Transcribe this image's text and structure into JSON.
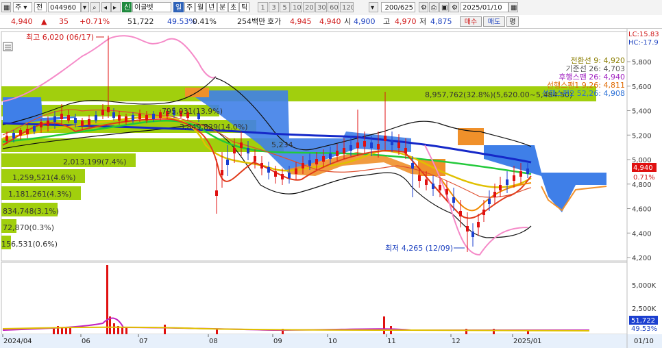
{
  "toolbar": {
    "period_mode": "주",
    "market_mode": "전",
    "code": "044960",
    "stock_tag": "신",
    "stock_name": "이글벳",
    "period_tabs": [
      "일",
      "주",
      "월",
      "년",
      "분",
      "초",
      "틱"
    ],
    "intervals": [
      "1",
      "3",
      "5",
      "10",
      "20",
      "30",
      "60",
      "120"
    ],
    "count": "200/625",
    "date": "2025/01/10"
  },
  "quote": {
    "price": "4,940",
    "change": "35",
    "change_rate": "+0.71%",
    "volume": "51,722",
    "volume_ratio": "49.53%",
    "turnover_rate": "0.41%",
    "amount": "254백만",
    "ask_label": "호가",
    "ask": "4,945",
    "bid": "4,940",
    "open_label": "시",
    "open": "4,900",
    "high_label": "고",
    "high": "4,970",
    "low_label": "저",
    "low": "4,875",
    "buy_label": "매수",
    "sell_label": "매도",
    "eval_label": "평"
  },
  "chart": {
    "corner_lc": "LC:15.83",
    "corner_hc": "HC:-17.9",
    "price_ticks": [
      "5,800",
      "5,600",
      "5,400",
      "5,200",
      "5,000",
      "4,800",
      "4,600",
      "4,400",
      "4,200"
    ],
    "current_price_tag": "4,940",
    "current_rate_tag": "0.71%",
    "high_note": "최고 6,020 (06/17)",
    "low_note": "최저 4,265 (12/09)",
    "ichimoku_legend": [
      {
        "text": "전환선 9: 4,920",
        "color": "#8a7d00"
      },
      {
        "text": "기준선 26: 4,703",
        "color": "#555555"
      },
      {
        "text": "후행스팬 26: 4,940",
        "color": "#a020c0"
      },
      {
        "text": "선행스팬1 9,26: 4,811",
        "color": "#e06a00"
      },
      {
        "text": "선행스팬2 52,26: 4,908",
        "color": "#2a6fd6"
      }
    ],
    "volume_profile": [
      "8,957,762(32.8%)(5,620.00~5,484.50)",
      "795,031(13.9%)",
      "3,849,829(14.0%)",
      "5,234",
      "2,013,199(7.4%)",
      "1,259,521(4.6%)",
      "1,181,261(4.3%)",
      "834,748(3.1%)",
      "72,870(0.3%)",
      "156,531(0.6%)"
    ],
    "vol_ticks": [
      "5,000K",
      "2,500K"
    ],
    "vol_tag": "51,722",
    "vol_rate_tag": "49.53%",
    "months": [
      "2024/04",
      "06",
      "07",
      "08",
      "09",
      "10",
      "11",
      "12",
      "2025/01"
    ],
    "axis_date": "01/10",
    "colors": {
      "up": "#e01010",
      "down": "#1b3fd0",
      "cloud_blue": "#3f7fe8",
      "cloud_orange": "#f0902a",
      "profile": "#9ccc00"
    }
  }
}
